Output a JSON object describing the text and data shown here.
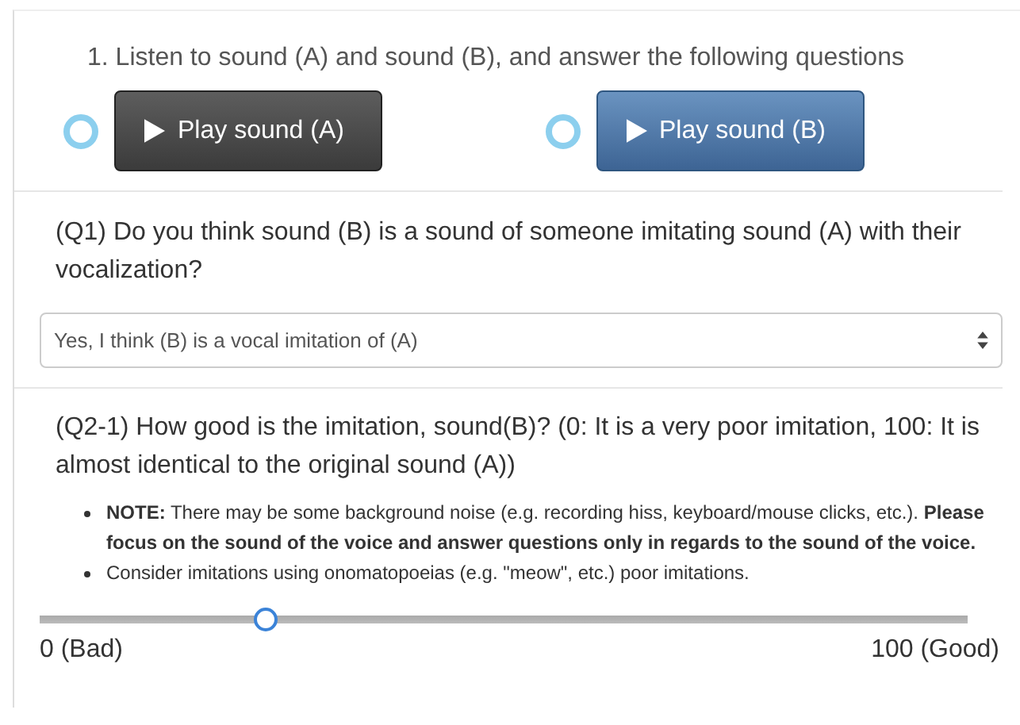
{
  "instruction": "1. Listen to sound (A) and sound (B), and answer the following questions",
  "players": [
    {
      "label": "Play sound (A)",
      "selected": false,
      "kind": "dark"
    },
    {
      "label": "Play sound (B)",
      "selected": false,
      "kind": "primary"
    }
  ],
  "q1": {
    "question": "(Q1) Do you think sound (B) is a sound of someone imitating sound (A) with their vocalization?",
    "value": "Yes, I think (B) is a vocal imitation of (A)"
  },
  "q2": {
    "question": "(Q2-1) How good is the imitation, sound(B)? (0: It is a very poor imitation, 100: It is almost identical to the original sound (A))",
    "notes": [
      "**NOTE:** There may be some background noise (e.g. recording hiss, keyboard/mouse clicks, etc.). **Please focus on the sound of the voice and answer questions only in regards to the sound of the voice.**",
      "Consider imitations using onomatopoeias (e.g. \"meow\", etc.) poor imitations."
    ],
    "slider": {
      "level": 0.243,
      "min_label": "0 (Bad)",
      "max_label": "100 (Good)"
    }
  }
}
